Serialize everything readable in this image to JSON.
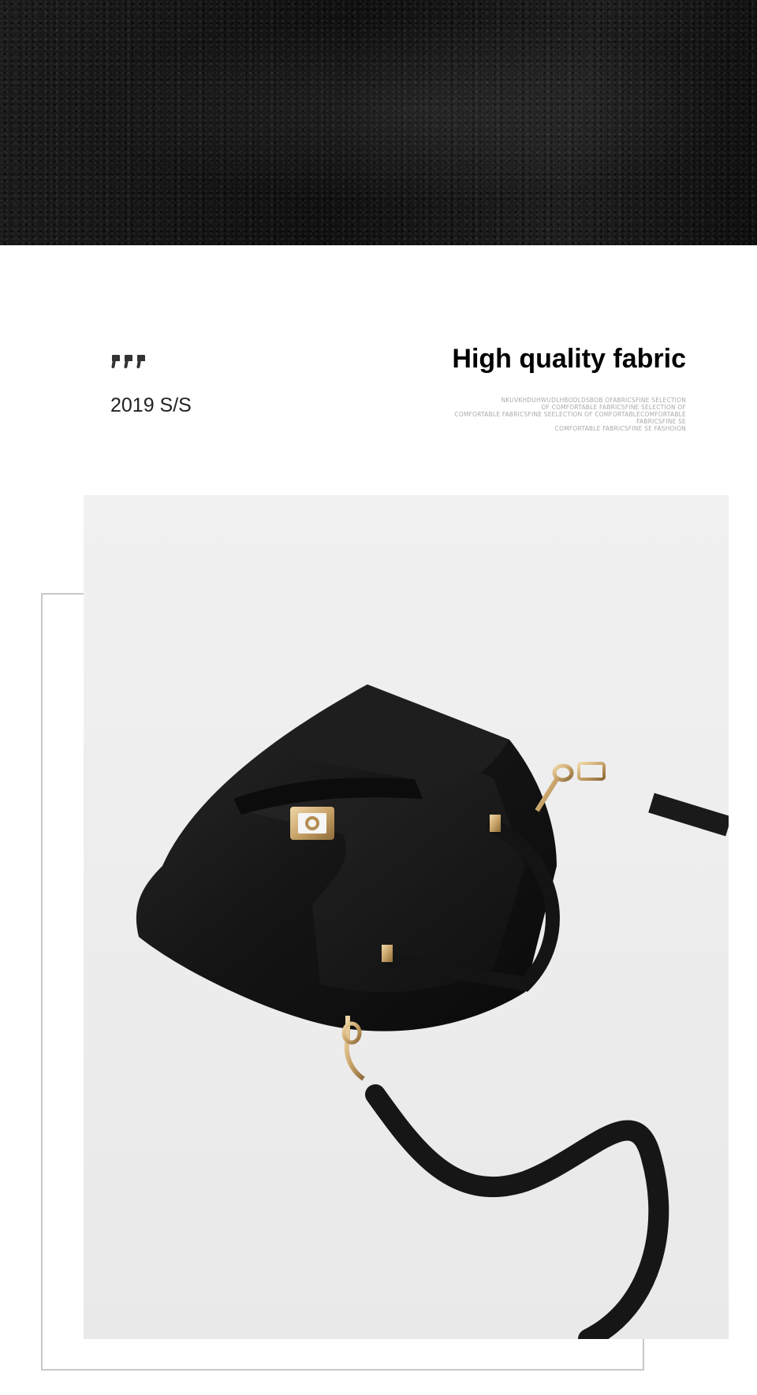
{
  "header": {
    "season": "2019 S/S",
    "title": "High quality fabric",
    "subtitle_lines": [
      "NKUVKHDUHWUDLHBODLDSBOB OFABRICSFINE SELECTION",
      "OF COMFORTABLE FABRICSFINE SELECTION OF",
      "COMFORTABLE FABRICSFINE SEELECTION OF COMFORTABLECOMFORTABLE",
      "FABRICSFINE SE",
      "COMFORTABLE FABRICSFINE SE FASHOION"
    ]
  },
  "colors": {
    "leather": "#141414",
    "hardware_gold": "#c9a46a",
    "frame": "#c8c8c8"
  }
}
